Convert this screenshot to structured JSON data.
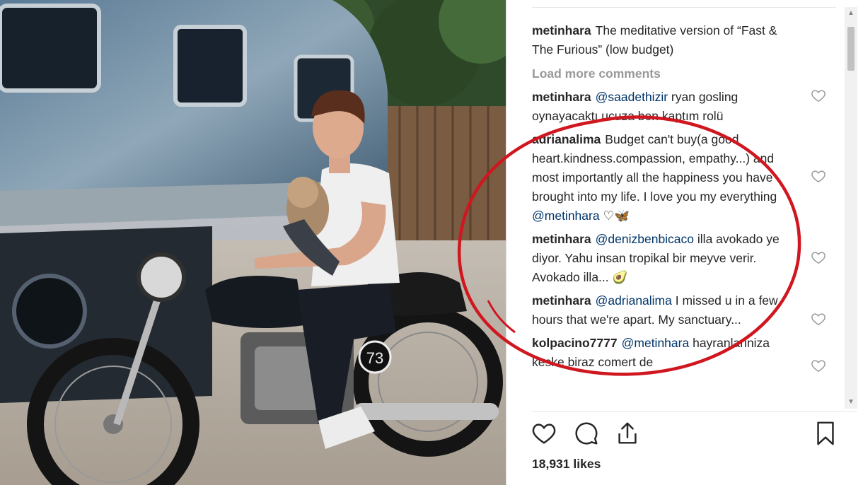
{
  "post": {
    "caption": {
      "user": "metinhara",
      "text": "The meditative version of “Fast & The Furious” (low budget)"
    },
    "load_more_label": "Load more comments",
    "comments": [
      {
        "user": "metinhara",
        "mention": "@saadethizir",
        "text": "ryan gosling oynayacaktı ucuza ben kaptım rolü"
      },
      {
        "user": "adrianalima",
        "mention": "",
        "text": "Budget can't buy(a good heart.kindness.compassion, empathy...) and most importantly all the happiness you have brought into my life. I love you my everything",
        "mention_end": "@metinhara",
        "emoji": "♡🦋"
      },
      {
        "user": "metinhara",
        "mention": "@denizbenbicaco",
        "text": "illa avokado ye diyor. Yahu insan tropikal bir meyve verir. Avokado illa...",
        "emoji": "🥑"
      },
      {
        "user": "metinhara",
        "mention": "@adrianalima",
        "text": "I missed u in a few hours that we're apart. My sanctuary..."
      },
      {
        "user": "kolpacino7777",
        "mention": "@metinhara",
        "text": "hayranlariniza keske biraz comert de"
      }
    ],
    "likes": "18,931 likes",
    "timestamp": ""
  },
  "photo": {
    "plate_number": "73"
  },
  "colors": {
    "username": "#262626",
    "mention": "#003569",
    "muted": "#999999",
    "annotation": "#d0161f"
  },
  "icons": {
    "like": "heart-icon",
    "comment": "comment-icon",
    "share": "share-icon",
    "save": "bookmark-icon"
  }
}
